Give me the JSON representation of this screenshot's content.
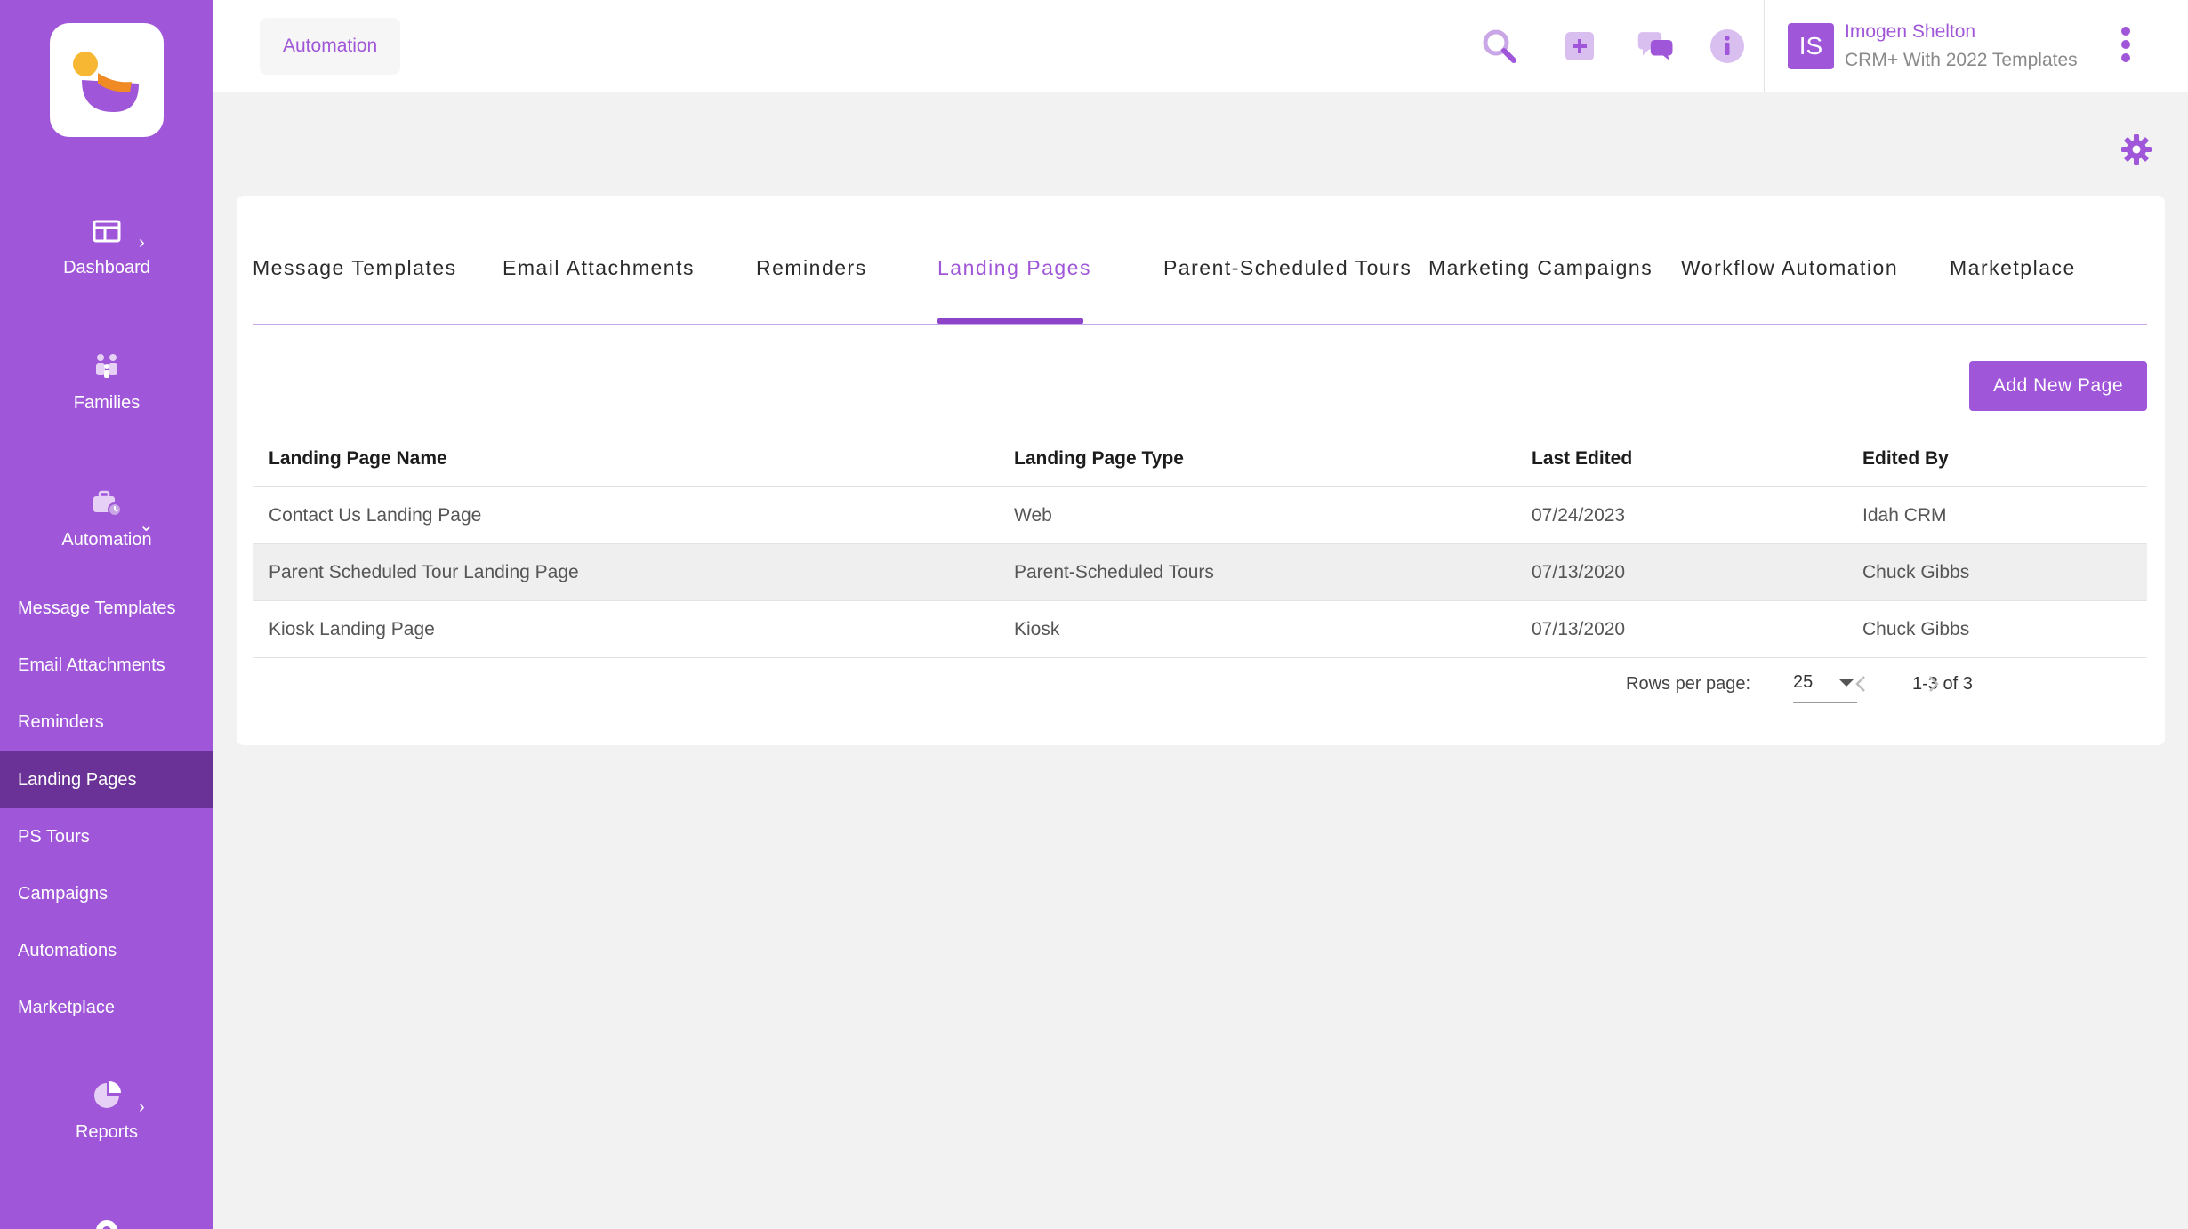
{
  "sidebar": {
    "main": [
      {
        "label": "Dashboard",
        "icon": "dashboard-icon"
      },
      {
        "label": "Families",
        "icon": "families-icon"
      },
      {
        "label": "Automation",
        "icon": "automation-icon"
      }
    ],
    "sub_items": [
      "Message Templates",
      "Email Attachments",
      "Reminders",
      "Landing Pages",
      "PS Tours",
      "Campaigns",
      "Automations",
      "Marketplace"
    ],
    "reports": {
      "label": "Reports",
      "icon": "reports-icon"
    },
    "active_sub": "Landing Pages"
  },
  "header": {
    "breadcrumb": "Automation",
    "user": {
      "initials": "IS",
      "name": "Imogen Shelton",
      "org": "CRM+ With 2022 Templates"
    }
  },
  "tabs": [
    "Message Templates",
    "Email Attachments",
    "Reminders",
    "Landing Pages",
    "Parent-Scheduled Tours",
    "Marketing Campaigns",
    "Workflow Automation",
    "Marketplace"
  ],
  "active_tab": "Landing Pages",
  "add_button_label": "Add New Page",
  "table": {
    "columns": [
      "Landing Page Name",
      "Landing Page Type",
      "Last Edited",
      "Edited By"
    ],
    "rows": [
      [
        "Contact Us Landing Page",
        "Web",
        "07/24/2023",
        "Idah CRM"
      ],
      [
        "Parent Scheduled Tour Landing Page",
        "Parent-Scheduled Tours",
        "07/13/2020",
        "Chuck Gibbs"
      ],
      [
        "Kiosk Landing Page",
        "Kiosk",
        "07/13/2020",
        "Chuck Gibbs"
      ]
    ]
  },
  "pagination": {
    "rows_per_page_label": "Rows per page:",
    "rows_per_page": "25",
    "range": "1-3 of 3"
  },
  "colors": {
    "accent": "#a056d8",
    "sidebar_active": "#6a3296",
    "background": "#f2f2f2"
  }
}
